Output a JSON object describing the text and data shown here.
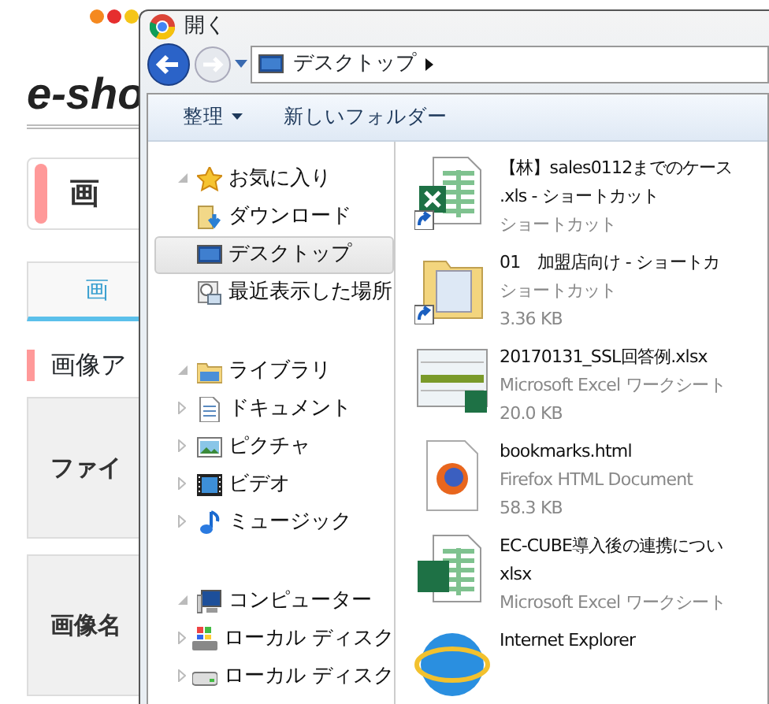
{
  "background_page": {
    "logo": "e-sho",
    "heading": "画",
    "tab": "画",
    "section_title": "画像ア",
    "form_labels": [
      "ファイ",
      "画像名"
    ]
  },
  "dialog": {
    "title": "開く",
    "address": {
      "path": [
        "デスクトップ"
      ]
    },
    "toolbar": [
      {
        "label": "整理",
        "kind": "menu"
      },
      {
        "label": "新しいフォルダー",
        "kind": "button"
      }
    ],
    "nav": [
      {
        "label": "お気に入り",
        "kind": "star",
        "expanded": true,
        "selected": false,
        "children": [
          {
            "label": "ダウンロード",
            "kind": "download",
            "selected": false
          },
          {
            "label": "デスクトップ",
            "kind": "desktop",
            "selected": true
          },
          {
            "label": "最近表示した場所",
            "kind": "recent",
            "selected": false
          }
        ]
      },
      {
        "label": "ライブラリ",
        "kind": "library",
        "expanded": true,
        "selected": false,
        "children": [
          {
            "label": "ドキュメント",
            "kind": "document",
            "expanded": false,
            "selected": false
          },
          {
            "label": "ピクチャ",
            "kind": "picture",
            "expanded": false,
            "selected": false
          },
          {
            "label": "ビデオ",
            "kind": "video",
            "expanded": false,
            "selected": false
          },
          {
            "label": "ミュージック",
            "kind": "music",
            "expanded": false,
            "selected": false
          }
        ]
      },
      {
        "label": "コンピューター",
        "kind": "computer",
        "expanded": true,
        "selected": false,
        "children": [
          {
            "label": "ローカル ディスク",
            "kind": "system-drive",
            "expanded": false,
            "selected": false
          },
          {
            "label": "ローカル ディスク",
            "kind": "drive",
            "expanded": false,
            "selected": false
          }
        ]
      }
    ],
    "files": [
      {
        "kind": "excel-shortcut",
        "name": [
          "【林】sales0112までのケース",
          ".xls - ショートカット"
        ],
        "details": [
          "ショートカット"
        ]
      },
      {
        "kind": "folder-shortcut",
        "name": [
          "01　加盟店向け - ショートカ"
        ],
        "details": [
          "ショートカット",
          "3.36 KB"
        ]
      },
      {
        "kind": "excel-thumbnail",
        "name": [
          "20170131_SSL回答例.xlsx"
        ],
        "details": [
          "Microsoft Excel ワークシート",
          "20.0 KB"
        ]
      },
      {
        "kind": "firefox-html",
        "name": [
          "bookmarks.html"
        ],
        "details": [
          "Firefox HTML Document",
          "58.3 KB"
        ]
      },
      {
        "kind": "excel",
        "name": [
          "EC-CUBE導入後の連携につい",
          "xlsx"
        ],
        "details": [
          "Microsoft Excel ワークシート"
        ]
      },
      {
        "kind": "ie",
        "name": [
          "Internet Explorer"
        ]
      }
    ]
  }
}
